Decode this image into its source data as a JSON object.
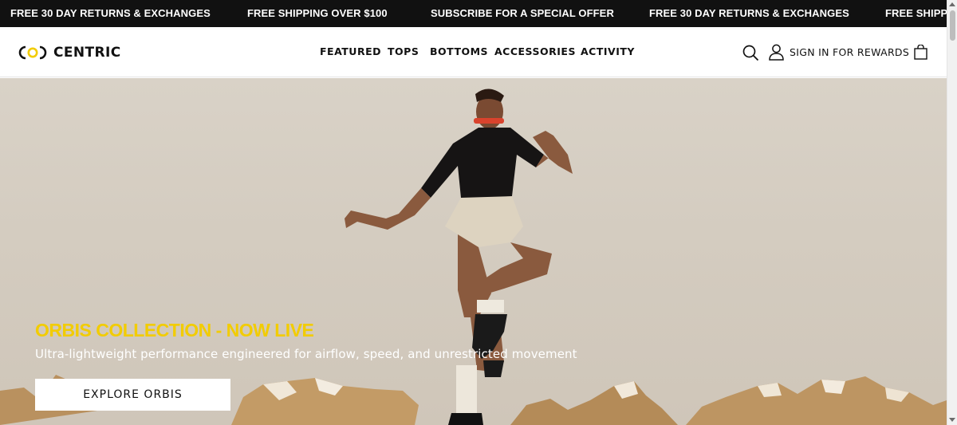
{
  "announcements": [
    "FREE 30 DAY RETURNS & EXCHANGES",
    "FREE SHIPPING OVER $100",
    "SUBSCRIBE FOR A SPECIAL OFFER",
    "FREE 30 DAY RETURNS & EXCHANGES",
    "FREE SHIPPIN"
  ],
  "header": {
    "logo_text": "CENTRIC",
    "nav": [
      "FEATURED",
      "TOPS",
      "BOTTOMS",
      "ACCESSORIES",
      "ACTIVITY"
    ],
    "signin_label": "SIGN IN FOR REWARDS"
  },
  "hero": {
    "title": "ORBIS COLLECTION - NOW LIVE",
    "subtitle": "Ultra-lightweight performance engineered for airflow, speed, and unrestricted movement",
    "button_label": "EXPLORE ORBIS"
  },
  "colors": {
    "announce_bg": "#111111",
    "accent_yellow": "#f2cc00",
    "hero_bg": "#d6cec2"
  },
  "icons": [
    "logo-mark-icon",
    "search-icon",
    "user-icon",
    "bag-icon"
  ]
}
